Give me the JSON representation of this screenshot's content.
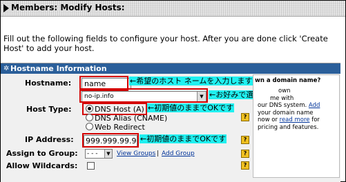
{
  "header": {
    "title": "Members: Modify Hosts:"
  },
  "intro": "Fill out the following fields to configure your host. After you are done click 'Create Host' to add your host.",
  "section": {
    "title": "Hostname Information"
  },
  "form": {
    "hostname_label": "Hostname:",
    "hostname_value": "name",
    "domain_value": "no-ip.info",
    "host_type_label": "Host Type:",
    "host_type_options": [
      "DNS Host (A)",
      "DNS Alias (CNAME)",
      "Web Redirect"
    ],
    "ip_label": "IP Address:",
    "ip_value": "999.999.99.9",
    "group_label": "Assign to Group:",
    "group_value": "- - -",
    "view_groups": "View Groups",
    "separator": "|",
    "add_group": "Add Group",
    "wildcards_label": "Allow Wildcards:"
  },
  "notes": {
    "hostname": "←希望のホスト ネームを入力します",
    "domain": "←お好みで選択します",
    "host_type": "←初期値のままでOKです",
    "ip": "←初期値のままでOKです"
  },
  "sidebar": {
    "title": "wn a domain name?",
    "lines": [
      "own",
      "me with",
      "our DNS system."
    ],
    "add_link": "Add",
    "line4": "your domain name",
    "line5_prefix": "now or ",
    "read_more": "read more",
    "line5_suffix": " for",
    "line6": "pricing and features."
  },
  "help_icon": "?",
  "colors": {
    "section_bar": "#2b5f9a",
    "highlight": "#d40000",
    "note_bg": "#20f0f0"
  }
}
